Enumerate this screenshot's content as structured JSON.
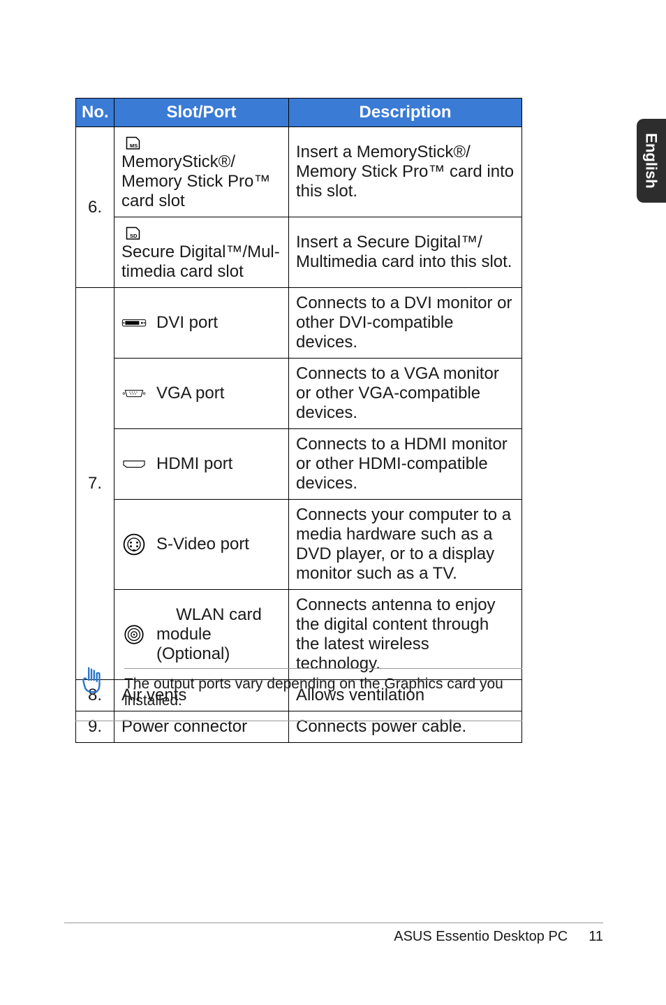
{
  "sideTab": "English",
  "headers": {
    "no": "No.",
    "slot": "Slot/Port",
    "desc": "Description"
  },
  "rows": {
    "r6a": {
      "num": "6.",
      "slot_line1": "MemoryStick®/",
      "slot_line2": "Memory Stick Pro™",
      "slot_line3": "card slot",
      "desc": "Insert a MemoryStick®/ Memory Stick Pro™ card into this slot."
    },
    "r6b": {
      "slot_line1": "Secure Digital™/Mul-",
      "slot_line2": "timedia card slot",
      "desc": "Insert a Secure Digital™/ Multimedia card into this slot."
    },
    "r7a": {
      "num": "7.",
      "slot": "DVI port",
      "desc": "Connects to a DVI monitor or other DVI-compatible devices."
    },
    "r7b": {
      "slot": "VGA port",
      "desc": "Connects to a VGA monitor or other VGA-compatible devices."
    },
    "r7c": {
      "slot": "HDMI port",
      "desc": "Connects to a HDMI monitor or other HDMI-compatible devices."
    },
    "r7d": {
      "slot": "S-Video port",
      "desc": "Connects your computer to a media hardware such as a DVD player, or to a display monitor such as a TV."
    },
    "r7e": {
      "slot_line1": "WLAN card",
      "slot_line2": "module (Optional)",
      "desc": "Connects antenna to enjoy the digital content through the latest wireless technology."
    },
    "r8": {
      "num": "8.",
      "slot": "Air vents",
      "desc": "Allows ventilation"
    },
    "r9": {
      "num": "9.",
      "slot": "Power connector",
      "desc": "Connects power cable."
    }
  },
  "note": "The output ports vary depending on the Graphics card you installed.",
  "footer": {
    "title": "ASUS Essentio Desktop PC",
    "page": "11"
  }
}
